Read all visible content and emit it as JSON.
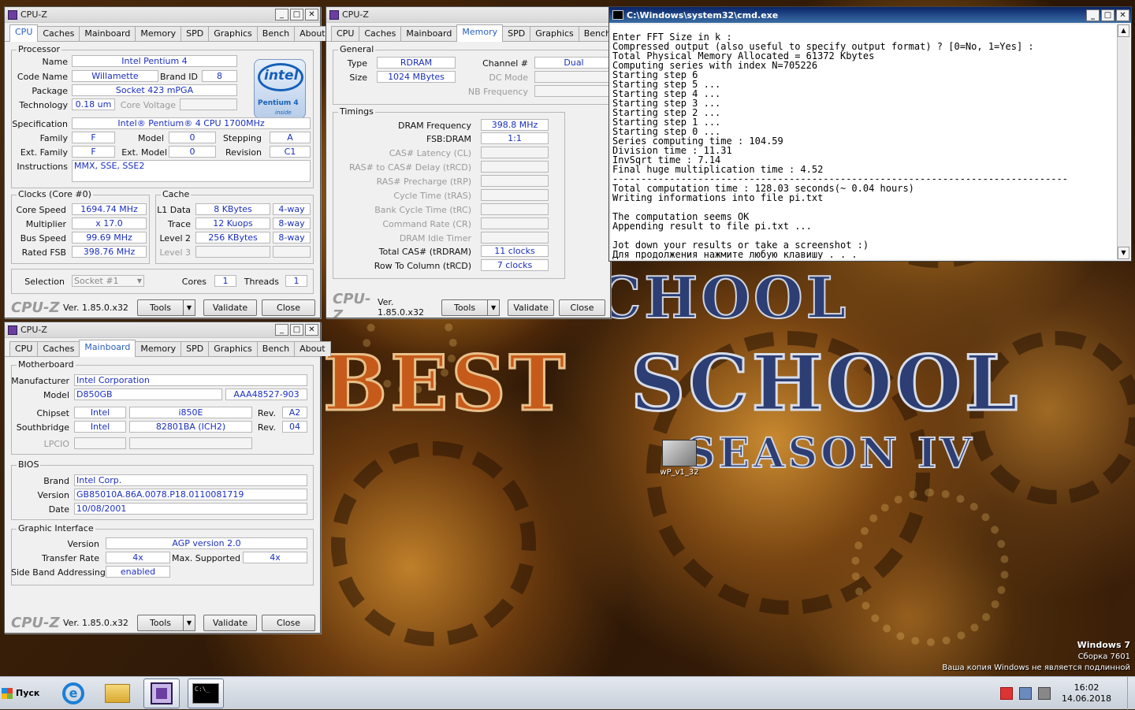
{
  "cpuz_cpu": {
    "title": "CPU-Z",
    "tabs": [
      "CPU",
      "Caches",
      "Mainboard",
      "Memory",
      "SPD",
      "Graphics",
      "Bench",
      "About"
    ],
    "processor": {
      "group": "Processor",
      "name_lbl": "Name",
      "name": "Intel Pentium 4",
      "codename_lbl": "Code Name",
      "codename": "Willamette",
      "brandid_lbl": "Brand ID",
      "brandid": "8",
      "package_lbl": "Package",
      "package": "Socket 423 mPGA",
      "tech_lbl": "Technology",
      "tech": "0.18 um",
      "corev_lbl": "Core Voltage",
      "spec_lbl": "Specification",
      "spec": "Intel® Pentium® 4 CPU 1700MHz",
      "family_lbl": "Family",
      "family": "F",
      "model_lbl": "Model",
      "model": "0",
      "stepping_lbl": "Stepping",
      "stepping": "A",
      "extfam_lbl": "Ext. Family",
      "extfam": "F",
      "extmodel_lbl": "Ext. Model",
      "extmodel": "0",
      "revision_lbl": "Revision",
      "revision": "C1",
      "instr_lbl": "Instructions",
      "instr": "MMX, SSE, SSE2"
    },
    "logo": {
      "brand": "intel",
      "product": "Pentium 4",
      "tag": "inside"
    },
    "clocks": {
      "group": "Clocks (Core #0)",
      "corespeed_lbl": "Core Speed",
      "corespeed": "1694.74 MHz",
      "mult_lbl": "Multiplier",
      "mult": "x 17.0",
      "bus_lbl": "Bus Speed",
      "bus": "99.69 MHz",
      "fsb_lbl": "Rated FSB",
      "fsb": "398.76 MHz"
    },
    "cache": {
      "group": "Cache",
      "l1_lbl": "L1 Data",
      "l1": "8 KBytes",
      "l1w": "4-way",
      "trace_lbl": "Trace",
      "trace": "12 Kuops",
      "tracew": "8-way",
      "l2_lbl": "Level 2",
      "l2": "256 KBytes",
      "l2w": "8-way",
      "l3_lbl": "Level 3"
    },
    "sel": {
      "selection_lbl": "Selection",
      "selection": "Socket #1",
      "cores_lbl": "Cores",
      "cores": "1",
      "threads_lbl": "Threads",
      "threads": "1"
    },
    "footer": {
      "logo": "CPU-Z",
      "version": "Ver. 1.85.0.x32",
      "tools": "Tools",
      "validate": "Validate",
      "close": "Close"
    }
  },
  "cpuz_mem": {
    "title": "CPU-Z",
    "tabs": [
      "CPU",
      "Caches",
      "Mainboard",
      "Memory",
      "SPD",
      "Graphics",
      "Bench",
      "A"
    ],
    "general": {
      "group": "General",
      "type_lbl": "Type",
      "type": "RDRAM",
      "channel_lbl": "Channel #",
      "channel": "Dual",
      "size_lbl": "Size",
      "size": "1024 MBytes",
      "dc_lbl": "DC Mode",
      "nb_lbl": "NB Frequency"
    },
    "timings": {
      "group": "Timings",
      "dram_lbl": "DRAM Frequency",
      "dram": "398.8 MHz",
      "fsb_lbl": "FSB:DRAM",
      "fsb": "1:1",
      "cas_lbl": "CAS# Latency (CL)",
      "rcd_lbl": "RAS# to CAS# Delay (tRCD)",
      "rp_lbl": "RAS# Precharge (tRP)",
      "ras_lbl": "Cycle Time (tRAS)",
      "rc_lbl": "Bank Cycle Time (tRC)",
      "cr_lbl": "Command Rate (CR)",
      "idle_lbl": "DRAM Idle Timer",
      "tcas_lbl": "Total CAS# (tRDRAM)",
      "tcas": "11 clocks",
      "trcd_lbl": "Row To Column (tRCD)",
      "trcd": "7 clocks"
    },
    "footer": {
      "logo": "CPU-Z",
      "version": "Ver. 1.85.0.x32",
      "tools": "Tools",
      "validate": "Validate",
      "close": "Close"
    }
  },
  "cpuz_mb": {
    "title": "CPU-Z",
    "tabs": [
      "CPU",
      "Caches",
      "Mainboard",
      "Memory",
      "SPD",
      "Graphics",
      "Bench",
      "About"
    ],
    "mb": {
      "group": "Motherboard",
      "manuf_lbl": "Manufacturer",
      "manuf": "Intel Corporation",
      "model_lbl": "Model",
      "model": "D850GB",
      "model2": "AAA48527-903",
      "chipset_lbl": "Chipset",
      "chipset": "Intel",
      "chipset2": "i850E",
      "rev_lbl": "Rev.",
      "rev": "A2",
      "south_lbl": "Southbridge",
      "south": "Intel",
      "south2": "82801BA (ICH2)",
      "rev2": "04",
      "lpcio_lbl": "LPCIO"
    },
    "bios": {
      "group": "BIOS",
      "brand_lbl": "Brand",
      "brand": "Intel Corp.",
      "version_lbl": "Version",
      "version": "GB85010A.86A.0078.P18.0110081719",
      "date_lbl": "Date",
      "date": "10/08/2001"
    },
    "gi": {
      "group": "Graphic Interface",
      "version_lbl": "Version",
      "version": "AGP version 2.0",
      "rate_lbl": "Transfer Rate",
      "rate": "4x",
      "max_lbl": "Max. Supported",
      "max": "4x",
      "sba_lbl": "Side Band Addressing",
      "sba": "enabled"
    },
    "footer": {
      "logo": "CPU-Z",
      "version": "Ver. 1.85.0.x32",
      "tools": "Tools",
      "validate": "Validate",
      "close": "Close"
    }
  },
  "cmd": {
    "title": "C:\\Windows\\system32\\cmd.exe",
    "lines": [
      "Enter FFT Size in k :",
      "Compressed output (also useful to specify output format) ? [0=No, 1=Yes] :",
      "Total Physical Memory Allocated = 61372 Kbytes",
      "Computing series with index N=705226",
      "Starting step 6",
      "Starting step 5 ...",
      "Starting step 4 ...",
      "Starting step 3 ...",
      "Starting step 2 ...",
      "Starting step 1 ...",
      "Starting step 0 ...",
      "Series computing time : 104.59",
      "Division time : 11.31",
      "InvSqrt time : 7.14",
      "Final huge multiplication time : 4.52",
      "--------------------------------------------------------------------------------",
      "Total computation time : 128.03 seconds(~ 0.04 hours)",
      "Writing informations into file pi.txt",
      "",
      "The computation seems OK",
      "Appending result to file pi.txt ...",
      "",
      "Jot down your results or take a screenshot :)",
      "Для продолжения нажмите любую клавишу . . ."
    ]
  },
  "desktop": {
    "wallpaper_line1": "SCHOOL",
    "wallpaper_best": "BEST",
    "wallpaper_school": "SCHOOL",
    "wallpaper_season": "SEASON IV",
    "icon_label": "wP_v1_32",
    "watermark1": "Windows 7",
    "watermark2": "Сборка 7601",
    "watermark3": "Ваша копия Windows не является подлинной"
  },
  "taskbar": {
    "start": "Пуск",
    "time": "16:02",
    "date": "14.06.2018"
  }
}
